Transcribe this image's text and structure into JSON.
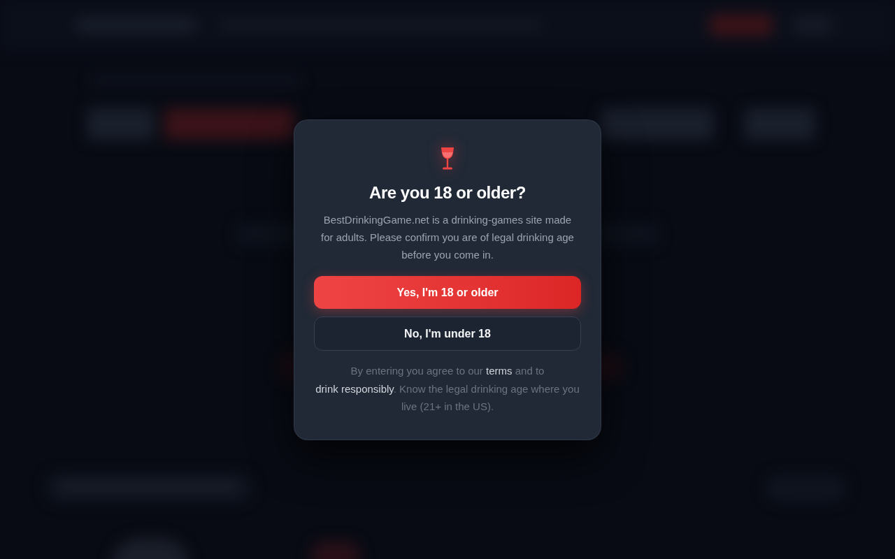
{
  "age_gate": {
    "title": "Are you 18 or older?",
    "message": "BestDrinkingGame.net is a drinking-games site made for adults. Please confirm you are of legal drinking age before you come in.",
    "buttons": [
      {
        "label": "Yes, I'm 18 or older",
        "kind": "primary"
      },
      {
        "label": "No, I'm under 18",
        "kind": "secondary"
      }
    ],
    "notice": [
      {
        "kind": "text",
        "text": "By entering you agree to our "
      },
      {
        "kind": "link",
        "text": "terms"
      },
      {
        "kind": "text",
        "text": " and to "
      },
      {
        "kind": "link",
        "text": "drink responsibly"
      },
      {
        "kind": "text",
        "text": ". Know the legal drinking age where you live (21+ in the US)."
      }
    ]
  }
}
